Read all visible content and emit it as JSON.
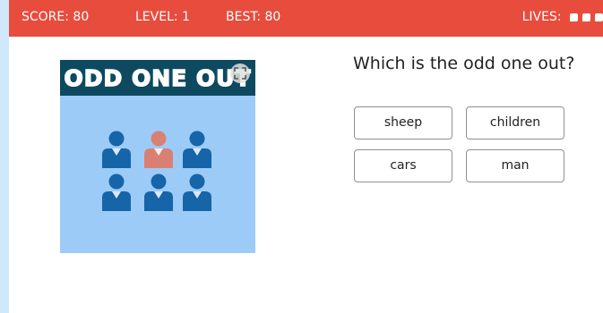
{
  "header": {
    "score": "SCORE: 80",
    "level": "LEVEL: 1",
    "best": "BEST: 80",
    "lives_label": "LIVES:",
    "lives_count": 3
  },
  "puzzle": {
    "title": "ODD ONE OUT",
    "icon": "zoom-expand-icon",
    "figures": [
      {
        "icon": "person-icon",
        "color": "#1565a8"
      },
      {
        "icon": "person-icon",
        "color": "#d98073"
      },
      {
        "icon": "person-icon",
        "color": "#1565a8"
      },
      {
        "icon": "person-icon",
        "color": "#1565a8"
      },
      {
        "icon": "person-icon",
        "color": "#1565a8"
      },
      {
        "icon": "person-icon",
        "color": "#1565a8"
      }
    ]
  },
  "question": "Which is the odd one out?",
  "choices": [
    "sheep",
    "children",
    "cars",
    "man"
  ],
  "colors": {
    "header_bg": "#e84c3d",
    "tile_bg": "#9dcbf7",
    "banner_bg": "#0d4a60",
    "figure_main": "#1565a8",
    "figure_odd": "#d98073",
    "page_edge": "#cfe8fb"
  }
}
